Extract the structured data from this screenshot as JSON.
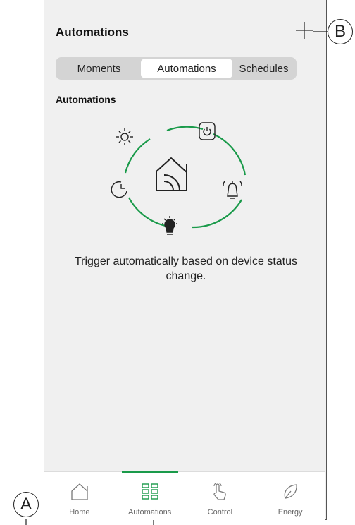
{
  "header": {
    "title": "Automations",
    "add_icon": "plus-icon"
  },
  "segments": [
    {
      "label": "Moments",
      "active": false
    },
    {
      "label": "Automations",
      "active": true
    },
    {
      "label": "Schedules",
      "active": false
    }
  ],
  "section_title": "Automations",
  "description": "Trigger automatically based on device status change.",
  "illustration": {
    "icons": [
      "sun-icon",
      "power-icon",
      "clock-icon",
      "alarm-bell-icon",
      "lightbulb-icon",
      "smart-home-icon"
    ],
    "accent_color": "#1a9a4a"
  },
  "tabs": [
    {
      "label": "Home",
      "icon": "home-icon",
      "active": false
    },
    {
      "label": "Automations",
      "icon": "grid-icon",
      "active": true
    },
    {
      "label": "Control",
      "icon": "hand-touch-icon",
      "active": false
    },
    {
      "label": "Energy",
      "icon": "leaf-icon",
      "active": false
    }
  ],
  "callouts": {
    "a": "A",
    "b": "B"
  }
}
